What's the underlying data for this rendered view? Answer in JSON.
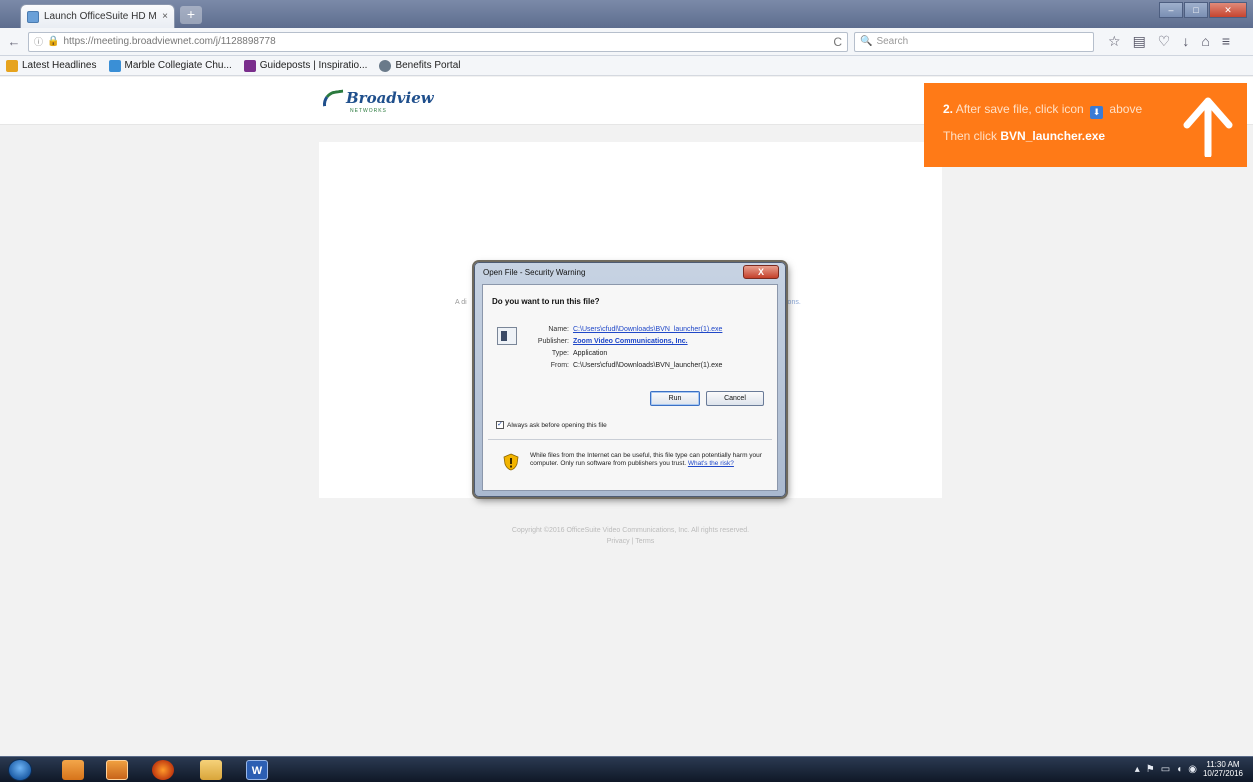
{
  "browser": {
    "tab_title": "Launch OfficeSuite HD Me...",
    "tab_close": "×",
    "new_tab": "+",
    "url": "https://meeting.broadviewnet.com/j/1128898778",
    "url_reload": "C",
    "search_placeholder": "Search",
    "window_controls": {
      "minimize": "‒",
      "maximize": "□",
      "close": "✕"
    }
  },
  "bookmarks": [
    {
      "label": "Latest Headlines",
      "color": "#e6a31e"
    },
    {
      "label": "Marble Collegiate Chu...",
      "color": "#3a8fd6"
    },
    {
      "label": "Guideposts | Inspiratio...",
      "color": "#7a2e8c"
    },
    {
      "label": "Benefits Portal",
      "color": "#6a7a8a"
    }
  ],
  "page": {
    "logo_text": "Broadview",
    "logo_sub": "NETWORKS",
    "side_text_left": "A di",
    "side_text_right": "ions.",
    "copyright_line1": "Copyright ©2016 OfficeSuite Video Communications, Inc. All rights reserved.",
    "copyright_line2": "Privacy | Terms"
  },
  "banner": {
    "step": "2.",
    "line1_a": "After save file, click icon",
    "line1_b": "above",
    "line2_a": "Then click",
    "line2_b": "BVN_launcher.exe",
    "color": "#ff7a17"
  },
  "dialog": {
    "title": "Open File - Security Warning",
    "close_glyph": "X",
    "question": "Do you want to run this file?",
    "fields": [
      {
        "key": "Name:",
        "value": "C:\\Users\\cfudl\\Downloads\\BVN_launcher(1).exe",
        "style": "link"
      },
      {
        "key": "Publisher:",
        "value": "Zoom Video Communications, Inc.",
        "style": "bold-link"
      },
      {
        "key": "Type:",
        "value": "Application",
        "style": "plain"
      },
      {
        "key": "From:",
        "value": "C:\\Users\\cfudl\\Downloads\\BVN_launcher(1).exe",
        "style": "plain"
      }
    ],
    "run_button": "Run",
    "cancel_button": "Cancel",
    "checkbox_label": "Always ask before opening this file",
    "checkbox_checked": true,
    "warning_text": "While files from the Internet can be useful, this file type can potentially harm your computer. Only run software from publishers you trust.",
    "warning_link": "What's the risk?"
  },
  "taskbar": {
    "word_label": "W",
    "clock_time": "11:30 AM",
    "clock_date": "10/27/2016"
  }
}
